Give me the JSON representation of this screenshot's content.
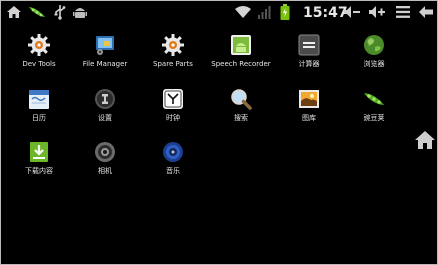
{
  "status_bar": {
    "time": "15:47",
    "left_icons": [
      "home-icon",
      "pea-pod-icon",
      "usb-icon",
      "android-debug-icon"
    ],
    "right_icons": [
      "wifi-icon",
      "signal-icon",
      "battery-icon",
      "volume-down-icon",
      "volume-up-icon",
      "menu-icon",
      "back-icon"
    ]
  },
  "apps": [
    {
      "label": "Dev Tools",
      "icon": "gear-icon"
    },
    {
      "label": "File Manager",
      "icon": "file-manager-icon"
    },
    {
      "label": "Spare Parts",
      "icon": "gear-icon"
    },
    {
      "label": "Speech Recorder",
      "icon": "speech-recorder-icon"
    },
    {
      "label": "计算器",
      "icon": "calculator-icon"
    },
    {
      "label": "浏览器",
      "icon": "globe-icon"
    },
    {
      "label": "日历",
      "icon": "calendar-icon"
    },
    {
      "label": "设置",
      "icon": "settings-icon"
    },
    {
      "label": "时钟",
      "icon": "clock-icon"
    },
    {
      "label": "搜索",
      "icon": "search-icon"
    },
    {
      "label": "图库",
      "icon": "gallery-icon"
    },
    {
      "label": "豌豆荚",
      "icon": "pea-pod-icon"
    },
    {
      "label": "下载内容",
      "icon": "download-icon"
    },
    {
      "label": "相机",
      "icon": "camera-icon"
    },
    {
      "label": "音乐",
      "icon": "music-icon"
    }
  ],
  "side_rail": {
    "icon": "home-icon"
  }
}
